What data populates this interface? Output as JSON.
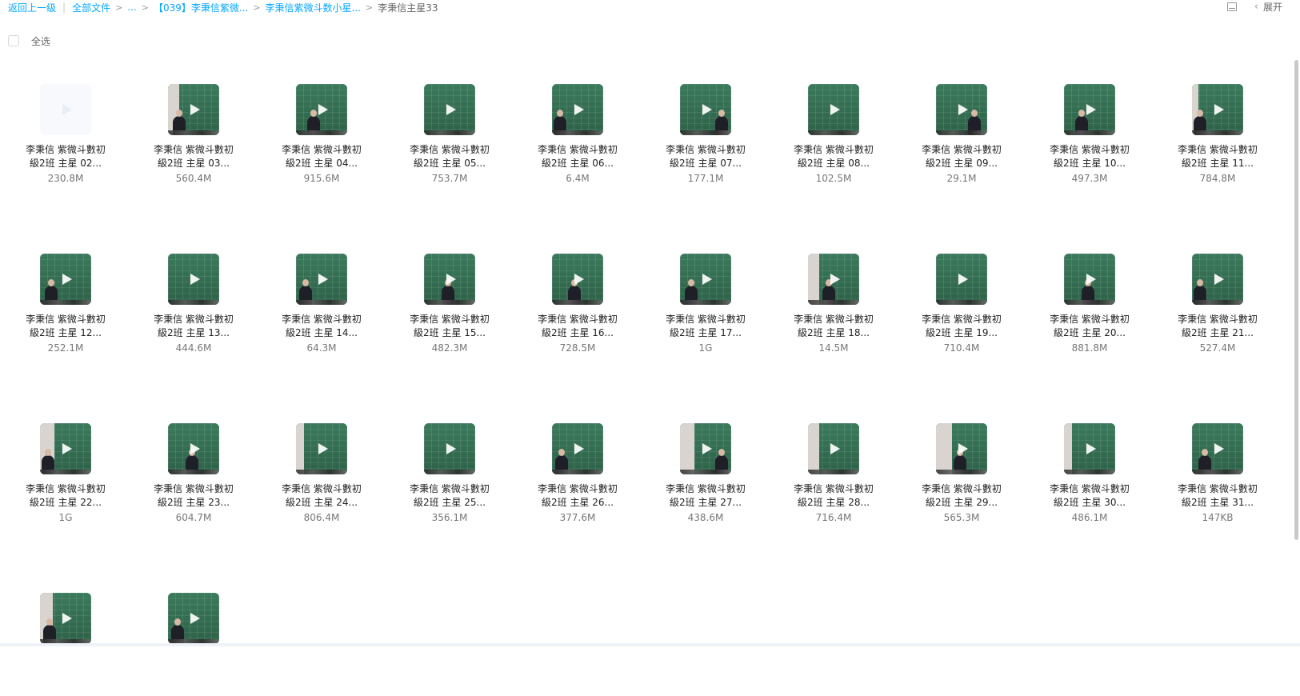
{
  "breadcrumb": {
    "back": "返回上一级",
    "all_files": "全部文件",
    "ellipsis": "...",
    "level1": "【039】李秉信紫微...",
    "level2": "李秉信紫微斗数小星...",
    "current": "李秉信主星33"
  },
  "toolbar": {
    "expand_label": "展开"
  },
  "select_all_label": "全选",
  "files": [
    {
      "line1": "李秉信 紫微斗數初",
      "line2": "級2班 主星 02...",
      "size": "230.8M"
    },
    {
      "line1": "李秉信 紫微斗數初",
      "line2": "級2班 主星 03...",
      "size": "560.4M"
    },
    {
      "line1": "李秉信 紫微斗數初",
      "line2": "級2班 主星 04...",
      "size": "915.6M"
    },
    {
      "line1": "李秉信 紫微斗數初",
      "line2": "級2班 主星 05...",
      "size": "753.7M"
    },
    {
      "line1": "李秉信 紫微斗數初",
      "line2": "級2班 主星 06...",
      "size": "6.4M"
    },
    {
      "line1": "李秉信 紫微斗數初",
      "line2": "級2班 主星 07...",
      "size": "177.1M"
    },
    {
      "line1": "李秉信 紫微斗數初",
      "line2": "級2班 主星 08...",
      "size": "102.5M"
    },
    {
      "line1": "李秉信 紫微斗數初",
      "line2": "級2班 主星 09...",
      "size": "29.1M"
    },
    {
      "line1": "李秉信 紫微斗數初",
      "line2": "級2班 主星 10...",
      "size": "497.3M"
    },
    {
      "line1": "李秉信 紫微斗數初",
      "line2": "級2班 主星 11...",
      "size": "784.8M"
    },
    {
      "line1": "李秉信 紫微斗數初",
      "line2": "級2班 主星 12...",
      "size": "252.1M"
    },
    {
      "line1": "李秉信 紫微斗數初",
      "line2": "級2班 主星 13...",
      "size": "444.6M"
    },
    {
      "line1": "李秉信 紫微斗數初",
      "line2": "級2班 主星 14...",
      "size": "64.3M"
    },
    {
      "line1": "李秉信 紫微斗數初",
      "line2": "級2班 主星 15...",
      "size": "482.3M"
    },
    {
      "line1": "李秉信 紫微斗數初",
      "line2": "級2班 主星 16...",
      "size": "728.5M"
    },
    {
      "line1": "李秉信 紫微斗數初",
      "line2": "級2班 主星 17...",
      "size": "1G"
    },
    {
      "line1": "李秉信 紫微斗數初",
      "line2": "級2班 主星 18...",
      "size": "14.5M"
    },
    {
      "line1": "李秉信 紫微斗數初",
      "line2": "級2班 主星 19...",
      "size": "710.4M"
    },
    {
      "line1": "李秉信 紫微斗數初",
      "line2": "級2班 主星 20...",
      "size": "881.8M"
    },
    {
      "line1": "李秉信 紫微斗數初",
      "line2": "級2班 主星 21...",
      "size": "527.4M"
    },
    {
      "line1": "李秉信 紫微斗數初",
      "line2": "級2班 主星 22...",
      "size": "1G"
    },
    {
      "line1": "李秉信 紫微斗數初",
      "line2": "級2班 主星 23...",
      "size": "604.7M"
    },
    {
      "line1": "李秉信 紫微斗數初",
      "line2": "級2班 主星 24...",
      "size": "806.4M"
    },
    {
      "line1": "李秉信 紫微斗數初",
      "line2": "級2班 主星 25...",
      "size": "356.1M"
    },
    {
      "line1": "李秉信 紫微斗數初",
      "line2": "級2班 主星 26...",
      "size": "377.6M"
    },
    {
      "line1": "李秉信 紫微斗數初",
      "line2": "級2班 主星 27...",
      "size": "438.6M"
    },
    {
      "line1": "李秉信 紫微斗數初",
      "line2": "級2班 主星 28...",
      "size": "716.4M"
    },
    {
      "line1": "李秉信 紫微斗數初",
      "line2": "級2班 主星 29...",
      "size": "565.3M"
    },
    {
      "line1": "李秉信 紫微斗數初",
      "line2": "級2班 主星 30...",
      "size": "486.1M"
    },
    {
      "line1": "李秉信 紫微斗數初",
      "line2": "級2班 主星 31...",
      "size": "147KB"
    },
    {
      "line1": "",
      "line2": "",
      "size": ""
    },
    {
      "line1": "",
      "line2": "",
      "size": ""
    }
  ],
  "theme": {
    "link_color": "#06a7ff"
  },
  "icons": [
    "list-view-icon",
    "chevron-left-icon",
    "play-icon"
  ]
}
